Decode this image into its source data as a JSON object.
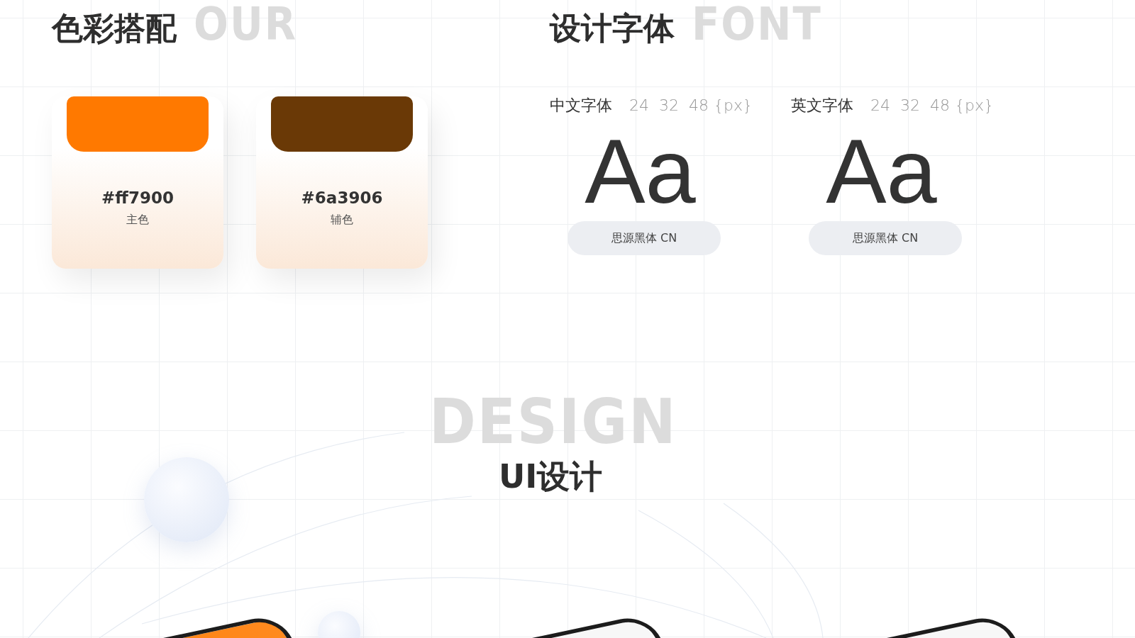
{
  "colors": {
    "ghost": "OUR",
    "title": "色彩搭配",
    "swatches": [
      {
        "hex": "#ff7900",
        "label": "主色",
        "color": "#ff7900"
      },
      {
        "hex": "#6a3906",
        "label": "辅色",
        "color": "#6a3906"
      }
    ]
  },
  "fonts": {
    "ghost": "FONT",
    "title": "设计字体",
    "items": [
      {
        "label": "中文字体",
        "sizes": "24  32  48 {px}",
        "sample": "Aa",
        "name": "思源黑体 CN"
      },
      {
        "label": "英文字体",
        "sizes": "24  32  48 {px}",
        "sample": "Aa",
        "name": "思源黑体 CN"
      }
    ]
  },
  "ui": {
    "ghost": "DESIGN",
    "title": "UI设计",
    "phones": [
      {
        "kind": "orange"
      },
      {
        "kind": "light"
      },
      {
        "kind": "light"
      }
    ]
  }
}
